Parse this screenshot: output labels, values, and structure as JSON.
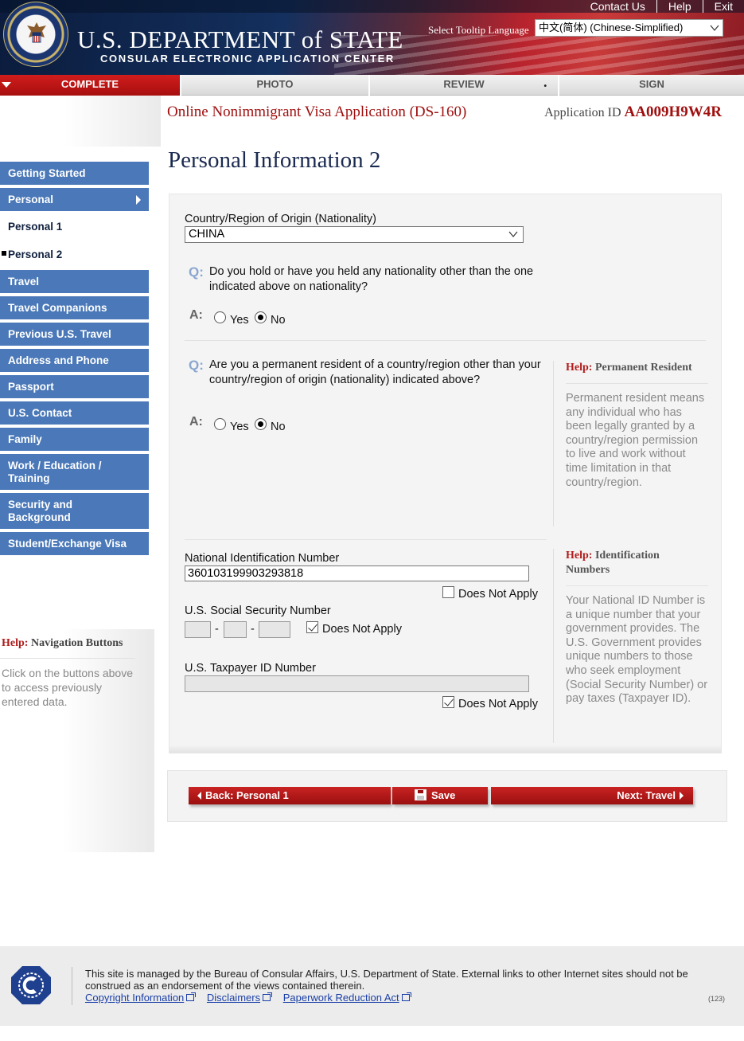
{
  "header": {
    "dept_title": "U.S. DEPARTMENT of STATE",
    "dept_subtitle": "CONSULAR ELECTRONIC APPLICATION CENTER",
    "links": [
      "Contact Us",
      "Help",
      "Exit"
    ],
    "tooltip_label": "Select Tooltip Language",
    "tooltip_language": "中文(简体)  (Chinese-Simplified)"
  },
  "steps": [
    {
      "label": "COMPLETE",
      "active": true
    },
    {
      "label": "PHOTO",
      "active": false
    },
    {
      "label": "REVIEW",
      "active": false
    },
    {
      "label": "SIGN",
      "active": false
    }
  ],
  "review_dot": "•",
  "form_title": "Online Nonimmigrant Visa Application (DS-160)",
  "app_id_label": "Application ID",
  "app_id_value": "AA009H9W4R",
  "page_heading": "Personal Information 2",
  "sidebar": {
    "items": [
      "Getting Started",
      "Personal",
      "Personal 1",
      "Personal 2",
      "Travel",
      "Travel Companions",
      "Previous U.S. Travel",
      "Address and Phone",
      "Passport",
      "U.S. Contact",
      "Family",
      "Work / Education / Training",
      "Security and Background",
      "Student/Exchange Visa"
    ],
    "help_heading_prefix": "Help:",
    "help_heading": "Navigation Buttons",
    "help_text": "Click on the buttons above to access previously entered data."
  },
  "form": {
    "nationality_label": "Country/Region of Origin (Nationality)",
    "nationality_value": "CHINA",
    "q_mark": "Q:",
    "a_mark": "A:",
    "q1": "Do you hold or have you held any nationality other than the one indicated above on nationality?",
    "q2": "Are you a permanent resident of a country/region other than your country/region of origin (nationality) indicated above?",
    "yes_label": "Yes",
    "no_label": "No",
    "q1_answer": "No",
    "q2_answer": "No",
    "national_id_label": "National Identification Number",
    "national_id_value": "360103199903293818",
    "does_not_apply": "Does Not Apply",
    "national_id_dna": false,
    "ssn_label": "U.S. Social Security Number",
    "ssn_dash": "-",
    "ssn_dna": true,
    "taxpayer_label": "U.S. Taxpayer ID Number",
    "taxpayer_dna": true
  },
  "help_permanent": {
    "prefix": "Help:",
    "title": "Permanent Resident",
    "text": "Permanent resident means any individual who has been legally granted by a country/region permission to live and work without time limitation in that country/region."
  },
  "help_id": {
    "prefix": "Help:",
    "title": "Identification Numbers",
    "text": "Your National ID Number is a unique number that your government provides. The U.S. Government provides unique numbers to those who seek employment (Social Security Number) or pay taxes (Taxpayer ID)."
  },
  "buttons": {
    "back": "Back: Personal 1",
    "save": "Save",
    "next": "Next: Travel"
  },
  "footer": {
    "text": "This site is managed by the Bureau of Consular Affairs, U.S. Department of State. External links to other Internet sites should not be construed as an endorsement of the views contained therein.",
    "links": [
      "Copyright Information",
      "Disclaimers",
      "Paperwork Reduction Act"
    ],
    "code": "(123)"
  },
  "colors": {
    "nav_blue": "#4a78b8",
    "accent_red": "#a01010",
    "button_red": "#b31919"
  }
}
